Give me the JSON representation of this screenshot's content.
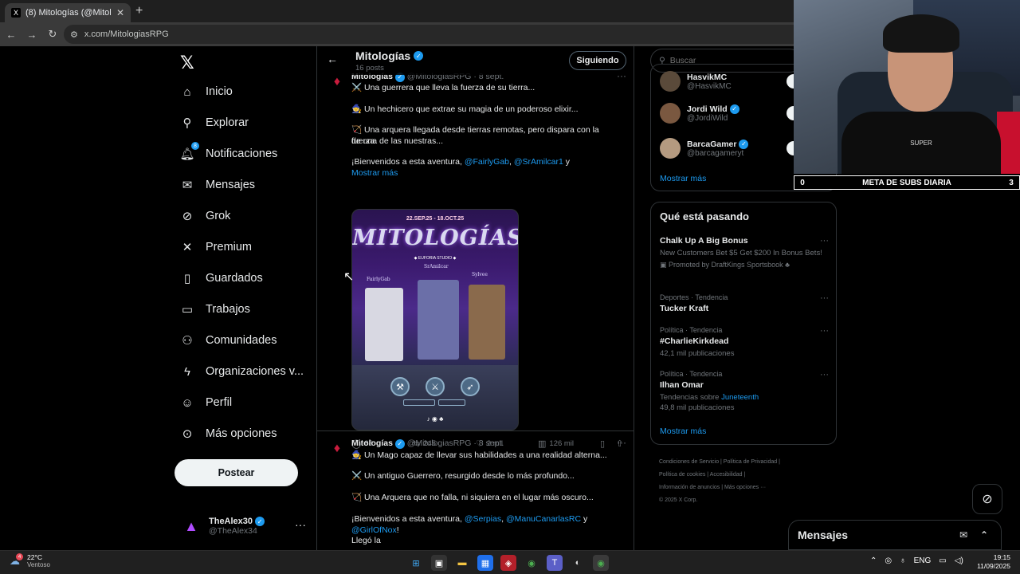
{
  "browser": {
    "tab_title": "(8) Mitologías (@MitologiasRPG",
    "url": "x.com/MitologiasRPG"
  },
  "nav": {
    "items": [
      "Inicio",
      "Explorar",
      "Notificaciones",
      "Mensajes",
      "Grok",
      "Premium",
      "Guardados",
      "Trabajos",
      "Comunidades",
      "Organizaciones v...",
      "Perfil",
      "Más opciones"
    ],
    "notification_badge": "8",
    "post_label": "Postear",
    "user_name": "TheAlex30",
    "user_handle": "@TheAlex34"
  },
  "profile": {
    "name": "Mitologías",
    "posts": "16 posts",
    "follow_label": "Siguiendo"
  },
  "tweet1": {
    "name": "Mitologías",
    "meta": "@MitologiasRPG · 8 sept.",
    "line1": "⚔️ Una guerrera que lleva la fuerza de su tierra...",
    "line2": "🧙 Un hechicero que extrae su magia de un poderoso elixir...",
    "line3a": "🏹 Una arquera llegada desde tierras remotas, pero dispara con la fuerza",
    "line3b": "de una de las nuestras...",
    "welcome": "¡Bienvenidos a esta aventura,",
    "mention1": "@FairlyGab",
    "comma": ",",
    "mention2": "@SrAmilcar1",
    "and": "y",
    "more": "Mostrar más",
    "image": {
      "date": "22.SEP.25 - 18.OCT.25",
      "title": "MITOLOGÍAS",
      "studio": "◆ EUFORIA STUDIO ◆",
      "n1": "FairlyGab",
      "n2": "SrAmilcar",
      "n3": "Sylvee",
      "socials": "♪ ◉ ♣"
    },
    "replies": "88",
    "reposts": "245",
    "likes": "2 mil",
    "views": "126 mil"
  },
  "tweet2": {
    "name": "Mitologías",
    "meta": "@MitologiasRPG · 8 sept.",
    "line1": "🧙 Un Mago capaz de llevar sus habilidades a una realidad alterna...",
    "line2": "⚔️ Un antiguo Guerrero, resurgido desde lo más profundo...",
    "line3": "🏹 Una Arquera que no falla, ni siquiera en el lugar más oscuro...",
    "welcome": "¡Bienvenidos a esta aventura,",
    "m1": "@Serpias",
    "m2": "@ManuCanarlasRC",
    "and": "y",
    "m3": "@GirlOfNox",
    "end": "!",
    "tail": "Llegó la"
  },
  "right": {
    "search_placeholder": "Buscar",
    "who": [
      {
        "name": "HasvikMC",
        "handle": "@HasvikMC"
      },
      {
        "name": "Jordi Wild",
        "handle": "@JordiWild"
      },
      {
        "name": "BarcaGamer",
        "handle": "@barcagameryt"
      }
    ],
    "show_more": "Mostrar más",
    "trends_title": "Qué está pasando",
    "promo": {
      "title": "Chalk Up A Big Bonus",
      "sub": "New Customers Bet $5 Get $200 In Bonus Bets!",
      "promoted": "Promoted by DraftKings Sportsbook"
    },
    "trends": [
      {
        "meta": "Deportes · Tendencia",
        "main": "Tucker Kraft",
        "sub": ""
      },
      {
        "meta": "Política · Tendencia",
        "main": "#CharlieKirkdead",
        "sub": "42,1 mil publicaciones"
      },
      {
        "meta": "Política · Tendencia",
        "main": "Ilhan Omar",
        "sub_pre": "Tendencias sobre",
        "sub_link": "Juneteenth",
        "sub2": "49,8 mil publicaciones"
      }
    ],
    "trends_more": "Mostrar más",
    "footer1": "Condiciones de Servicio  |  Política de Privacidad  |",
    "footer2": "Política de cookies  |  Accesibilidad  |",
    "footer3": "Información de anuncios  |  Más opciones ···",
    "footer4": "© 2025 X Corp.",
    "messages": "Mensajes"
  },
  "stream": {
    "subs_left": "0",
    "subs_label": "META DE SUBS DIARIA",
    "subs_right": "3",
    "shirt": "SUPER"
  },
  "taskbar": {
    "temp": "22°C",
    "weather": "Ventoso",
    "weather_badge": "4",
    "lang": "ENG",
    "time": "19:15",
    "date": "11/09/2025"
  }
}
